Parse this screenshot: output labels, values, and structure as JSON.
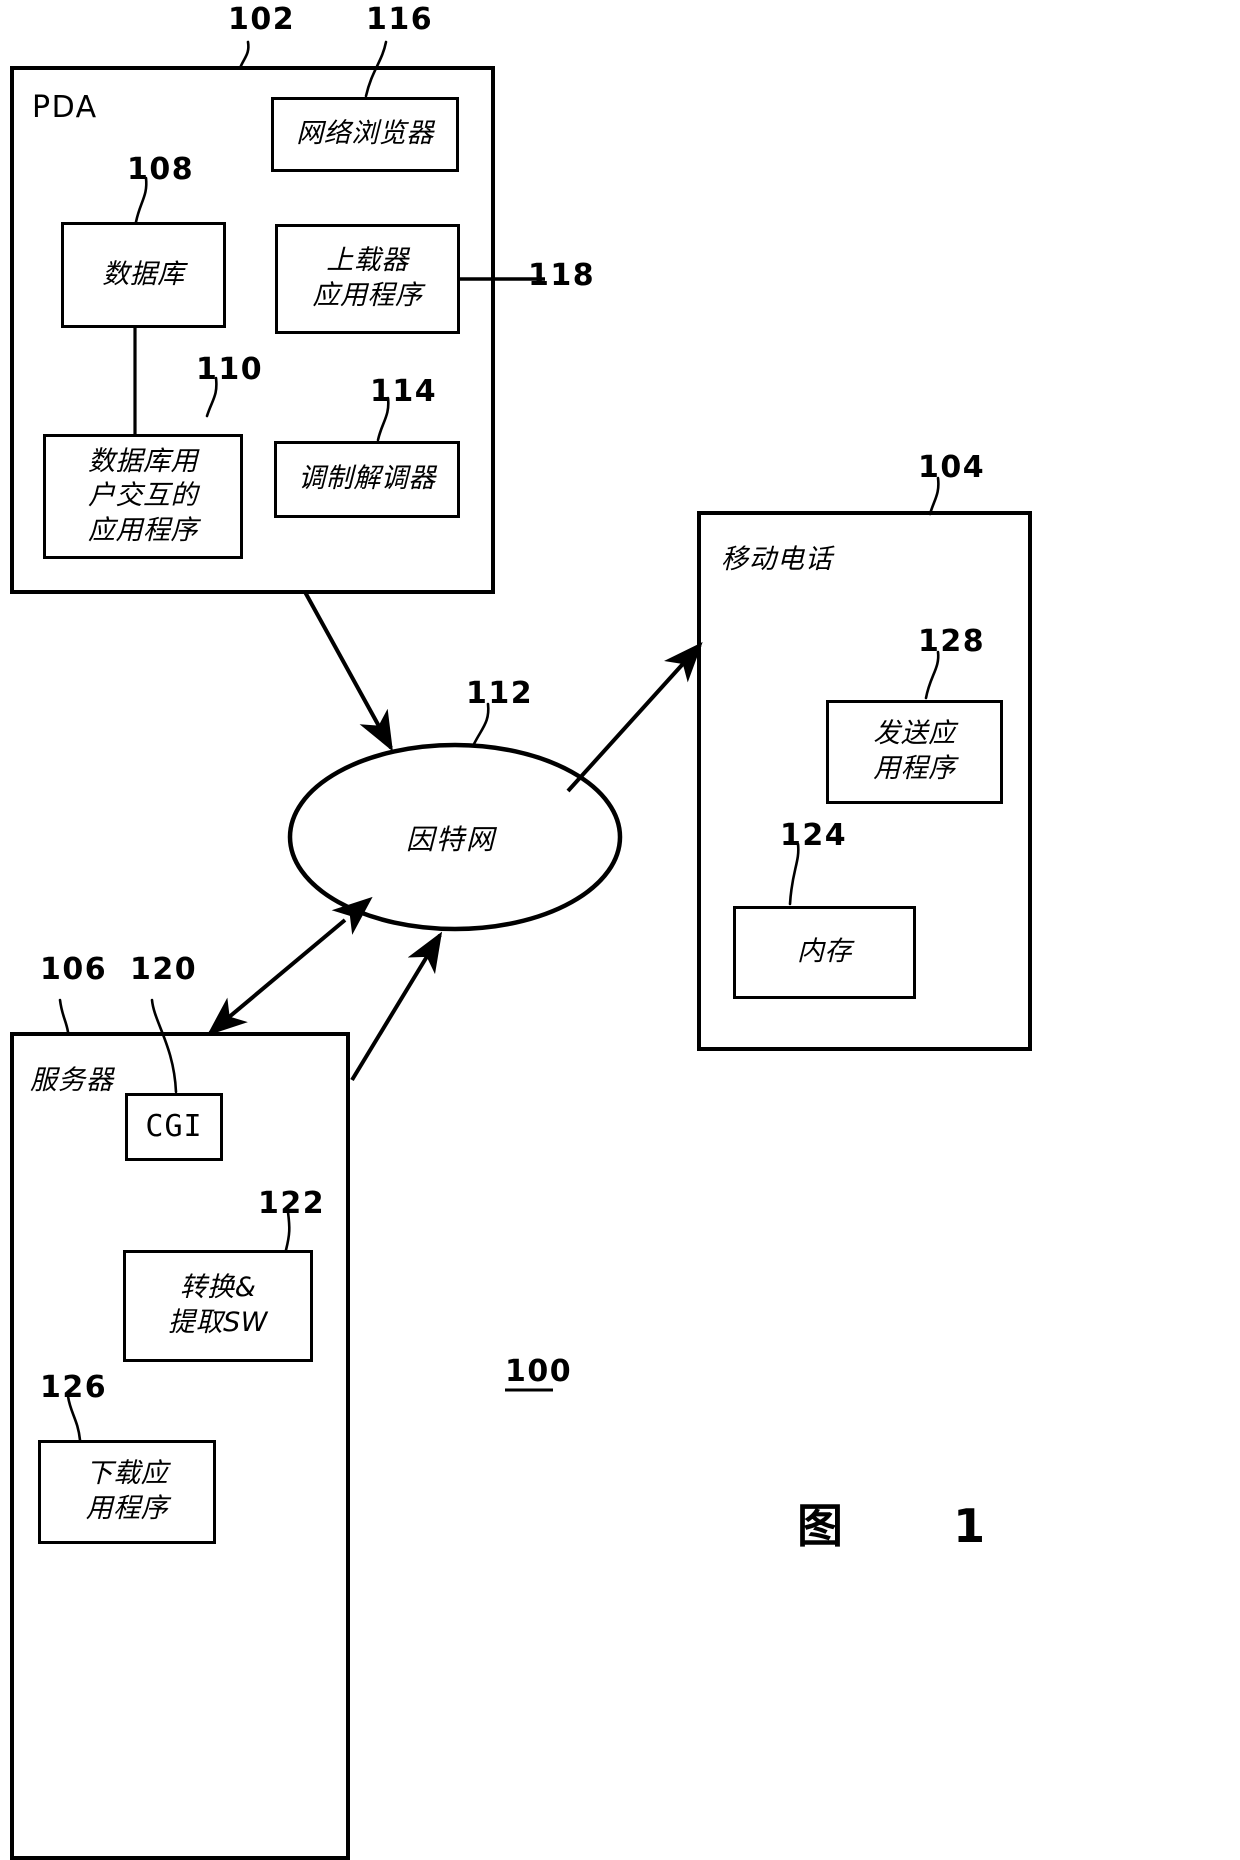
{
  "figure": {
    "caption": "图      1",
    "system_ref": "100"
  },
  "pda": {
    "ref": "102",
    "title": "PDA",
    "blocks": [
      {
        "ref": "116",
        "label": "网络浏览器"
      },
      {
        "ref": "118",
        "label": "上载器\n应用程序"
      },
      {
        "ref": "108",
        "label": "数据库"
      },
      {
        "ref": "110",
        "label": "数据库用\n户交互的\n应用程序"
      },
      {
        "ref": "114",
        "label": "调制解调器"
      }
    ]
  },
  "internet": {
    "ref": "112",
    "label": "因特网"
  },
  "mobile_phone": {
    "ref": "104",
    "title": "移动电话",
    "blocks": [
      {
        "ref": "128",
        "label": "发送应\n用程序"
      },
      {
        "ref": "124",
        "label": "内存"
      }
    ]
  },
  "server": {
    "ref": "106",
    "title": "服务器",
    "blocks": [
      {
        "ref": "120",
        "label": "CGI"
      },
      {
        "ref": "122",
        "label": "转换&\n提取SW"
      },
      {
        "ref": "126",
        "label": "下载应\n用程序"
      }
    ]
  }
}
